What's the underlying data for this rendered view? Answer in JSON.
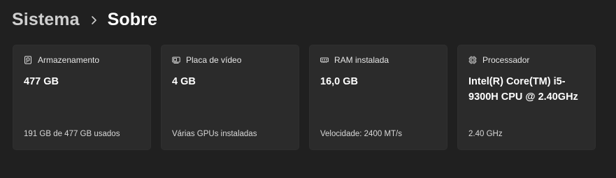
{
  "breadcrumb": {
    "parent": "Sistema",
    "current": "Sobre"
  },
  "cards": [
    {
      "icon": "storage-drive-icon",
      "label": "Armazenamento",
      "value": "477 GB",
      "detail": "191 GB de 477 GB usados"
    },
    {
      "icon": "display-adapter-icon",
      "label": "Placa de vídeo",
      "value": "4 GB",
      "detail": "Várias GPUs instaladas"
    },
    {
      "icon": "memory-ram-icon",
      "label": "RAM instalada",
      "value": "16,0 GB",
      "detail": "Velocidade: 2400 MT/s"
    },
    {
      "icon": "processor-chip-icon",
      "label": "Processador",
      "value": "Intel(R) Core(TM) i5-9300H CPU @ 2.40GHz",
      "detail": "2.40 GHz"
    }
  ]
}
